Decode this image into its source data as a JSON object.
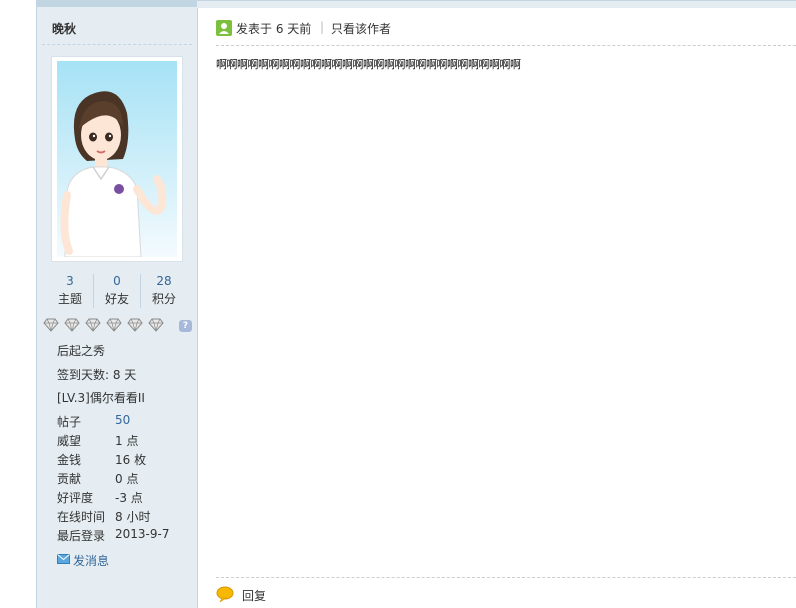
{
  "user": {
    "name": "晚秋",
    "avatar_alt": "avatar",
    "stats": [
      {
        "value": "3",
        "label": "主题"
      },
      {
        "value": "0",
        "label": "好友"
      },
      {
        "value": "28",
        "label": "积分"
      }
    ],
    "medal_count": 6,
    "rank_title": "后起之秀",
    "checkin": "签到天数: 8 天",
    "level": "[LV.3]偶尔看看II",
    "details": [
      {
        "key": "帖子",
        "value": "50"
      },
      {
        "key": "威望",
        "value": "1 点"
      },
      {
        "key": "金钱",
        "value": "16 枚"
      },
      {
        "key": "贡献",
        "value": "0 点"
      },
      {
        "key": "好评度",
        "value": "-3 点"
      },
      {
        "key": "在线时间",
        "value": "8 小时"
      },
      {
        "key": "最后登录",
        "value": "2013-9-7"
      }
    ],
    "send_message": "发消息"
  },
  "post": {
    "time": "发表于 6 天前",
    "separator": "|",
    "only_author": "只看该作者",
    "content": "啊啊啊啊啊啊啊啊啊啊啊啊啊啊啊啊啊啊啊啊啊啊啊啊啊啊啊啊啊",
    "reply_label": "回复"
  },
  "colors": {
    "sidebar_bg": "#e5edf2",
    "border": "#c2d5e3",
    "link": "#336699"
  },
  "icons": [
    "user-online-icon",
    "gem-medal-icon",
    "help-icon",
    "envelope-icon",
    "reply-bubble-icon"
  ]
}
